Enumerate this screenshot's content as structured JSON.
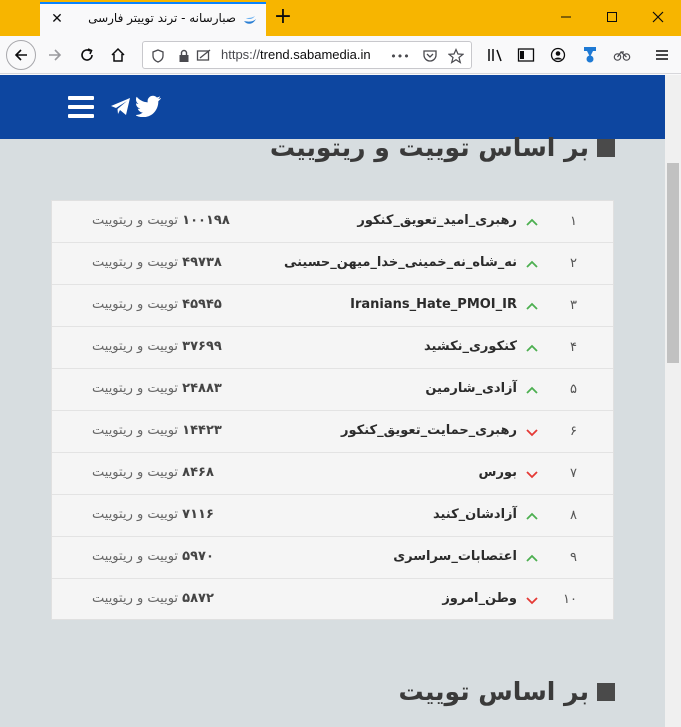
{
  "browser": {
    "tab_title": "صبارسانه - ترند توییتر فارسی",
    "tab_close": "✕",
    "new_tab": "+",
    "url_prefix": "https://",
    "url_host": "trend.sabamedia.in",
    "url_more": "•••"
  },
  "site": {
    "section1_title": "بر اساس توییت و ریتوییت",
    "section2_title": "بر اساس توییت",
    "count_suffix": "توییت و ریتوییت",
    "colors": {
      "header": "#0d46a0",
      "up": "#4caf50",
      "down": "#e53935"
    }
  },
  "trends": [
    {
      "rank": "۱",
      "tag": "رهبری_امید_تعویق_کنکور",
      "count": "۱۰۰۱۹۸",
      "trend": "up"
    },
    {
      "rank": "۲",
      "tag": "نه_شاه_نه_خمینی_خدا_میهن_حسینی",
      "count": "۴۹۷۳۸",
      "trend": "up"
    },
    {
      "rank": "۳",
      "tag": "Iranians_Hate_PMOI_IR",
      "count": "۴۵۹۴۵",
      "trend": "up"
    },
    {
      "rank": "۴",
      "tag": "کنکوری_نکشید",
      "count": "۳۷۶۹۹",
      "trend": "up"
    },
    {
      "rank": "۵",
      "tag": "آزادی_شارمین",
      "count": "۲۴۸۸۳",
      "trend": "up"
    },
    {
      "rank": "۶",
      "tag": "رهبری_حمایت_تعویق_کنکور",
      "count": "۱۴۴۲۳",
      "trend": "down"
    },
    {
      "rank": "۷",
      "tag": "بورس",
      "count": "۸۴۶۸",
      "trend": "down"
    },
    {
      "rank": "۸",
      "tag": "آزادشان_کنید",
      "count": "۷۱۱۶",
      "trend": "up"
    },
    {
      "rank": "۹",
      "tag": "اعتصابات_سراسری",
      "count": "۵۹۷۰",
      "trend": "up"
    },
    {
      "rank": "۱۰",
      "tag": "وطن_امروز",
      "count": "۵۸۷۲",
      "trend": "down"
    }
  ]
}
